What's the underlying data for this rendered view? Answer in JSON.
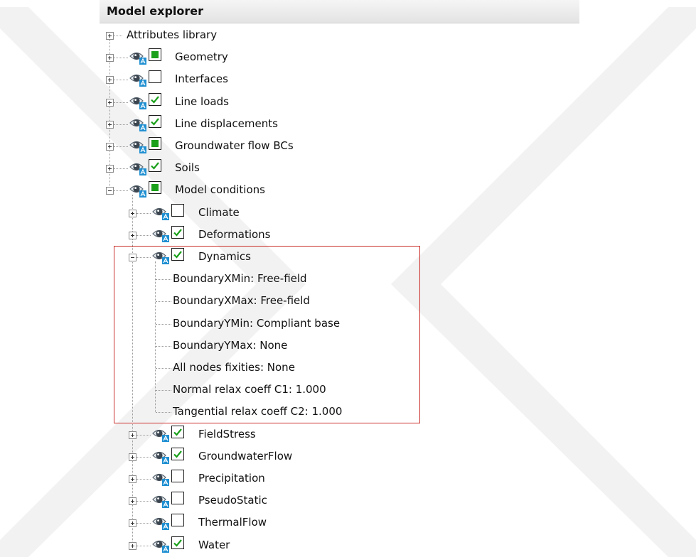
{
  "panel_title": "Model explorer",
  "tree": {
    "root": {
      "label": "Attributes library"
    },
    "top_items": [
      {
        "label": "Geometry",
        "check": "filled"
      },
      {
        "label": "Interfaces",
        "check": "empty"
      },
      {
        "label": "Line loads",
        "check": "checked"
      },
      {
        "label": "Line displacements",
        "check": "checked"
      },
      {
        "label": "Groundwater flow BCs",
        "check": "filled"
      },
      {
        "label": "Soils",
        "check": "checked"
      }
    ],
    "model_conditions": {
      "label": "Model conditions",
      "check": "filled",
      "children_before": [
        {
          "label": "Climate",
          "check": "empty"
        },
        {
          "label": "Deformations",
          "check": "checked"
        }
      ],
      "dynamics": {
        "label": "Dynamics",
        "check": "checked",
        "properties": [
          "BoundaryXMin: Free-field",
          "BoundaryXMax: Free-field",
          "BoundaryYMin: Compliant base",
          "BoundaryYMax: None",
          "All nodes fixities: None",
          "Normal relax coeff C1: 1.000",
          "Tangential relax coeff C2: 1.000"
        ]
      },
      "children_after": [
        {
          "label": "FieldStress",
          "check": "checked"
        },
        {
          "label": "GroundwaterFlow",
          "check": "checked"
        },
        {
          "label": "Precipitation",
          "check": "empty"
        },
        {
          "label": "PseudoStatic",
          "check": "empty"
        },
        {
          "label": "ThermalFlow",
          "check": "empty"
        },
        {
          "label": "Water",
          "check": "checked"
        }
      ]
    }
  },
  "icons": {
    "visibility": "eye-icon",
    "expand": "plus-icon",
    "collapse": "minus-icon"
  },
  "colors": {
    "check_green": "#1aa01a",
    "highlight_border": "#c9302c",
    "eye_blue": "#1f8fd1"
  }
}
